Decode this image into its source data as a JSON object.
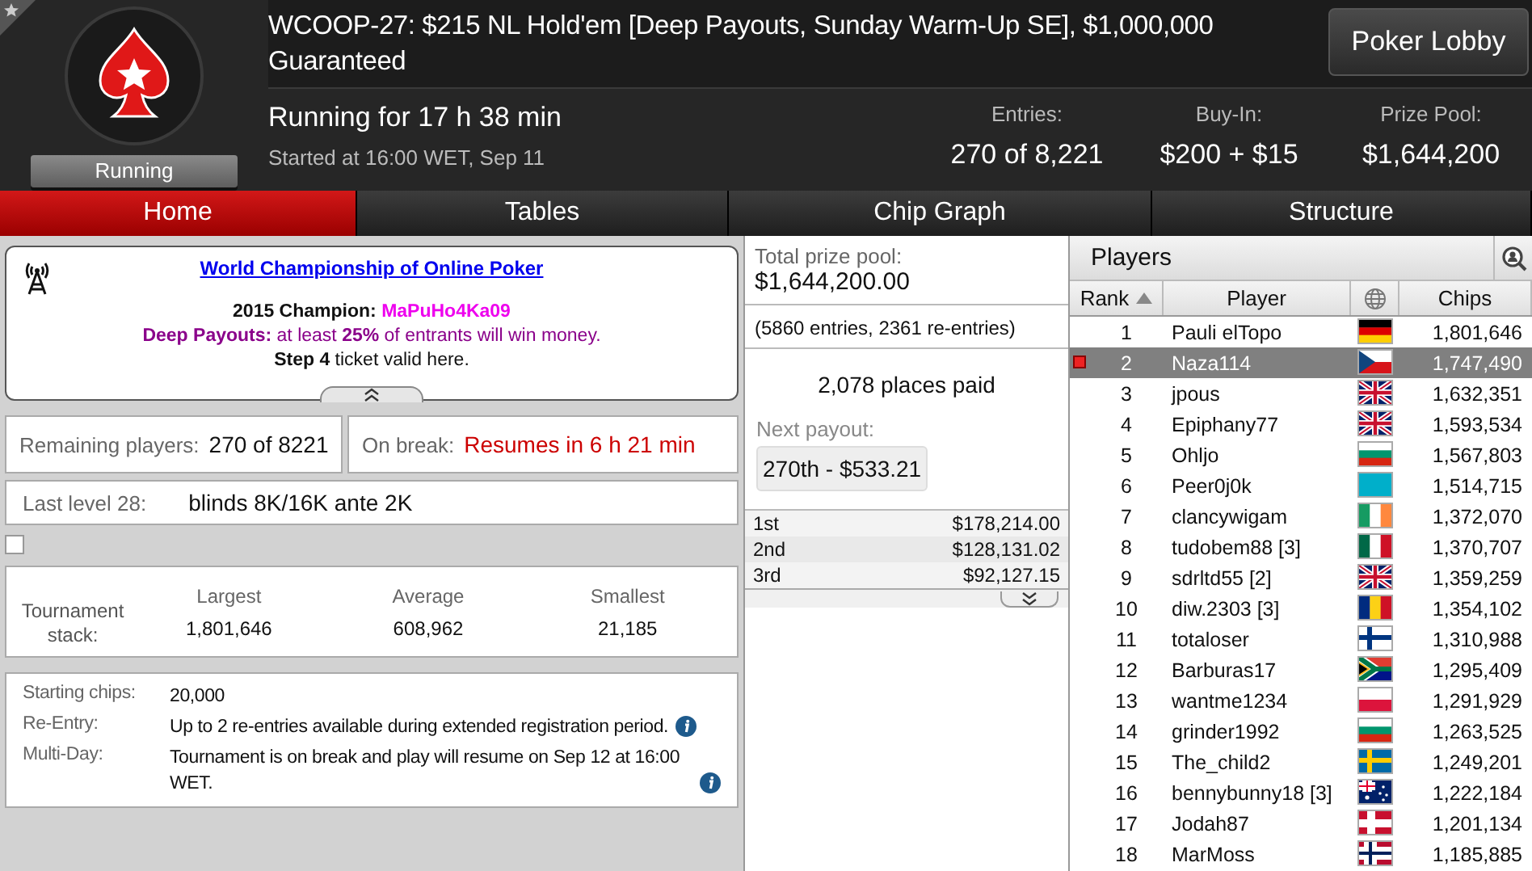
{
  "header": {
    "title": "WCOOP-27: $215 NL Hold'em [Deep Payouts, Sunday Warm-Up SE], $1,000,000 Guaranteed",
    "status": "Running",
    "running_for": "Running for 17 h 38 min",
    "started": "Started at 16:00 WET, Sep 11",
    "lobby_button": "Poker Lobby",
    "stats": [
      {
        "label": "Entries:",
        "value": "270 of 8,221"
      },
      {
        "label": "Buy-In:",
        "value": "$200 + $15"
      },
      {
        "label": "Prize Pool:",
        "value": "$1,644,200"
      }
    ]
  },
  "tabs": [
    {
      "label": "Home",
      "selected": true
    },
    {
      "label": "Tables",
      "selected": false
    },
    {
      "label": "Chip Graph",
      "selected": false
    },
    {
      "label": "Structure",
      "selected": false
    }
  ],
  "banner": {
    "link": "World Championship of Online Poker",
    "champion_label": "2015 Champion:",
    "champion": "MaPuHo4Ka09",
    "payouts_note": "**Deep Payouts:** at least **25%** of entrants will win money.",
    "ticket_note": "**Step 4** ticket valid here."
  },
  "remaining": {
    "label": "Remaining players:",
    "value": "270 of 8221"
  },
  "break": {
    "label": "On break:",
    "value": "Resumes in 6 h 21 min"
  },
  "level": {
    "label": "Last level 28:",
    "value": "blinds 8K/16K ante 2K"
  },
  "option": {
    "checked": false
  },
  "stack": {
    "label": "Tournament stack:",
    "columns": [
      {
        "label": "Largest",
        "value": "1,801,646"
      },
      {
        "label": "Average",
        "value": "608,962"
      },
      {
        "label": "Smallest",
        "value": "21,185"
      }
    ]
  },
  "info": [
    {
      "label": "Starting chips:",
      "value": "20,000",
      "info": false
    },
    {
      "label": "Re-Entry:",
      "value": "Up to 2 re-entries available during extended registration period.",
      "info": true
    },
    {
      "label": "Multi-Day:",
      "value": "Tournament is on break and play will resume on Sep 12 at 16:00 WET.",
      "info": true
    }
  ],
  "prize": {
    "label": "Total prize pool:",
    "value": "$1,644,200.00",
    "entries": "(5860 entries, 2361 re-entries)",
    "places": "2,078 places paid",
    "next_label": "Next payout:",
    "next": "270th - $533.21",
    "payouts": [
      {
        "place": "1st",
        "amount": "$178,214.00"
      },
      {
        "place": "2nd",
        "amount": "$128,131.02"
      },
      {
        "place": "3rd",
        "amount": "$92,127.15"
      }
    ]
  },
  "players": {
    "title": "Players",
    "columns": [
      {
        "label": "Rank",
        "sorted": true
      },
      {
        "label": "Player",
        "sorted": false
      },
      {
        "label": "Chips",
        "sorted": false
      }
    ],
    "rows": [
      {
        "rank": "1",
        "name": "Pauli elTopo",
        "chips": "1,801,646",
        "selected": false,
        "flag": {
          "kind": "h",
          "stripes": [
            {
              "color": "#000000"
            },
            {
              "color": "#dd0000"
            },
            {
              "color": "#ffce00"
            }
          ]
        }
      },
      {
        "rank": "2",
        "name": "Naza114",
        "chips": "1,747,490",
        "selected": true,
        "flag": {
          "kind": "cz",
          "stripes": [
            {
              "color": "#ffffff"
            },
            {
              "color": "#d7141a"
            },
            {
              "color": "#11457e"
            }
          ]
        }
      },
      {
        "rank": "3",
        "name": "jpous",
        "chips": "1,632,351",
        "selected": false,
        "flag": {
          "kind": "uk",
          "stripes": [
            {
              "color": "#012169"
            },
            {
              "color": "#ffffff"
            },
            {
              "color": "#c8102e"
            }
          ]
        }
      },
      {
        "rank": "4",
        "name": "Epiphany77",
        "chips": "1,593,534",
        "selected": false,
        "flag": {
          "kind": "uk",
          "stripes": [
            {
              "color": "#012169"
            },
            {
              "color": "#ffffff"
            },
            {
              "color": "#c8102e"
            }
          ]
        }
      },
      {
        "rank": "5",
        "name": "Ohljo",
        "chips": "1,567,803",
        "selected": false,
        "flag": {
          "kind": "h",
          "stripes": [
            {
              "color": "#ffffff"
            },
            {
              "color": "#00966e"
            },
            {
              "color": "#d62612"
            }
          ]
        }
      },
      {
        "rank": "6",
        "name": "Peer0j0k",
        "chips": "1,514,715",
        "selected": false,
        "flag": {
          "kind": "h",
          "stripes": [
            {
              "color": "#00afca"
            }
          ]
        }
      },
      {
        "rank": "7",
        "name": "clancywigam",
        "chips": "1,372,070",
        "selected": false,
        "flag": {
          "kind": "v",
          "stripes": [
            {
              "color": "#169b62"
            },
            {
              "color": "#ffffff"
            },
            {
              "color": "#ff883e"
            }
          ]
        }
      },
      {
        "rank": "8",
        "name": "tudobem88 [3]",
        "chips": "1,370,707",
        "selected": false,
        "flag": {
          "kind": "v",
          "stripes": [
            {
              "color": "#006847"
            },
            {
              "color": "#ffffff"
            },
            {
              "color": "#ce1126"
            }
          ]
        }
      },
      {
        "rank": "9",
        "name": "sdrltd55 [2]",
        "chips": "1,359,259",
        "selected": false,
        "flag": {
          "kind": "uk",
          "stripes": [
            {
              "color": "#012169"
            },
            {
              "color": "#ffffff"
            },
            {
              "color": "#c8102e"
            }
          ]
        }
      },
      {
        "rank": "10",
        "name": "diw.2303 [3]",
        "chips": "1,354,102",
        "selected": false,
        "flag": {
          "kind": "v",
          "stripes": [
            {
              "color": "#002b7f"
            },
            {
              "color": "#fcd116"
            },
            {
              "color": "#ce1126"
            }
          ]
        }
      },
      {
        "rank": "11",
        "name": "totaloser",
        "chips": "1,310,988",
        "selected": false,
        "flag": {
          "kind": "cross",
          "stripes": [
            {
              "color": "#ffffff"
            },
            {
              "color": "#003580"
            }
          ]
        }
      },
      {
        "rank": "12",
        "name": "Barburas17",
        "chips": "1,295,409",
        "selected": false,
        "flag": {
          "kind": "za",
          "stripes": [
            {
              "color": "#e03c31"
            },
            {
              "color": "#001489"
            },
            {
              "color": "#007749"
            },
            {
              "color": "#000000"
            },
            {
              "color": "#ffb81c"
            }
          ]
        }
      },
      {
        "rank": "13",
        "name": "wantme1234",
        "chips": "1,291,929",
        "selected": false,
        "flag": {
          "kind": "h",
          "stripes": [
            {
              "color": "#ffffff"
            },
            {
              "color": "#dc143c"
            }
          ]
        }
      },
      {
        "rank": "14",
        "name": "grinder1992",
        "chips": "1,263,525",
        "selected": false,
        "flag": {
          "kind": "h",
          "stripes": [
            {
              "color": "#ffffff"
            },
            {
              "color": "#00966e"
            },
            {
              "color": "#d62612"
            }
          ]
        }
      },
      {
        "rank": "15",
        "name": "The_child2",
        "chips": "1,249,201",
        "selected": false,
        "flag": {
          "kind": "cross",
          "stripes": [
            {
              "color": "#006aa7"
            },
            {
              "color": "#fecc00"
            }
          ]
        }
      },
      {
        "rank": "16",
        "name": "bennybunny18 [3]",
        "chips": "1,222,184",
        "selected": false,
        "flag": {
          "kind": "au",
          "stripes": [
            {
              "color": "#012169"
            },
            {
              "color": "#ffffff"
            },
            {
              "color": "#e4002b"
            }
          ]
        }
      },
      {
        "rank": "17",
        "name": "Jodah87",
        "chips": "1,201,134",
        "selected": false,
        "flag": {
          "kind": "cross",
          "stripes": [
            {
              "color": "#c8102e"
            },
            {
              "color": "#ffffff"
            }
          ]
        }
      },
      {
        "rank": "18",
        "name": "MarMoss",
        "chips": "1,185,885",
        "selected": false,
        "flag": {
          "kind": "nordic2",
          "stripes": [
            {
              "color": "#ba0c2f"
            },
            {
              "color": "#ffffff"
            },
            {
              "color": "#00205b"
            }
          ]
        }
      }
    ]
  }
}
